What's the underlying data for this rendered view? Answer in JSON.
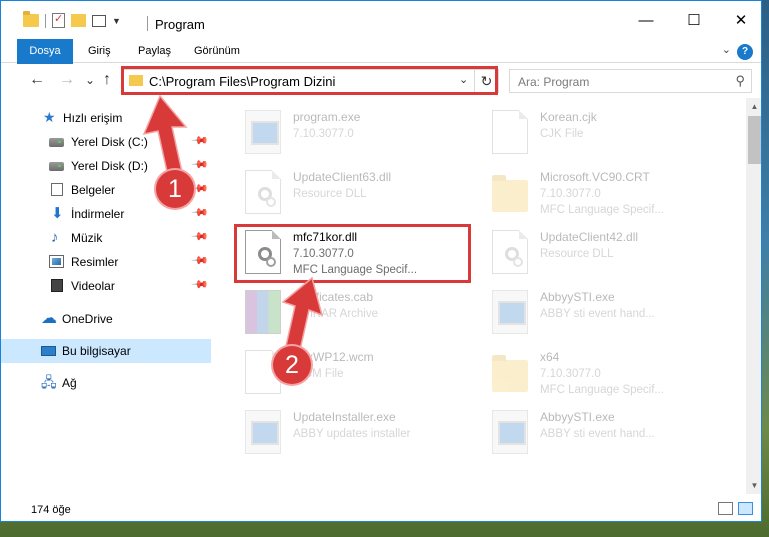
{
  "window": {
    "title": "Program",
    "controls": {
      "minimize": "—",
      "maximize": "☐",
      "close": "✕"
    }
  },
  "ribbon": {
    "tabs": [
      "Dosya",
      "Giriş",
      "Paylaş",
      "Görünüm"
    ],
    "help": "?"
  },
  "nav": {
    "back": "←",
    "forward": "→",
    "recent": "⌄",
    "up": "↑",
    "address": "C:\\Program Files\\Program Dizini",
    "search_placeholder": "Ara: Program"
  },
  "sidebar": {
    "items": [
      {
        "label": "Hızlı erişim",
        "icon": "star-icon",
        "pinned": false
      },
      {
        "label": "Yerel Disk (C:)",
        "icon": "drive-icon",
        "pinned": true
      },
      {
        "label": "Yerel Disk (D:)",
        "icon": "drive-icon",
        "pinned": true
      },
      {
        "label": "Belgeler",
        "icon": "documents-icon",
        "pinned": true
      },
      {
        "label": "İndirmeler",
        "icon": "downloads-icon",
        "pinned": true
      },
      {
        "label": "Müzik",
        "icon": "music-icon",
        "pinned": true
      },
      {
        "label": "Resimler",
        "icon": "pictures-icon",
        "pinned": true
      },
      {
        "label": "Videolar",
        "icon": "videos-icon",
        "pinned": true
      },
      {
        "label": "OneDrive",
        "icon": "onedrive-icon",
        "pinned": false
      },
      {
        "label": "Bu bilgisayar",
        "icon": "this-pc-icon",
        "pinned": false,
        "selected": true
      },
      {
        "label": "Ağ",
        "icon": "network-icon",
        "pinned": false
      }
    ]
  },
  "files": [
    {
      "name": "program.exe",
      "line2": "7.10.3077.0",
      "line3": "",
      "icon": "exe-icon"
    },
    {
      "name": "Korean.cjk",
      "line2": "CJK File",
      "line3": "",
      "icon": "file-icon"
    },
    {
      "name": "UpdateClient63.dll",
      "line2": "Resource DLL",
      "line3": "",
      "icon": "dll-icon"
    },
    {
      "name": "Microsoft.VC90.CRT",
      "line2": "7.10.3077.0",
      "line3": "MFC Language Specif...",
      "icon": "folder-icon"
    },
    {
      "name": "mfc71kor.dll",
      "line2": "7.10.3077.0",
      "line3": "MFC Language Specif...",
      "icon": "dll-icon",
      "highlighted": true
    },
    {
      "name": "UpdateClient42.dll",
      "line2": "Resource DLL",
      "line3": "",
      "icon": "dll-icon"
    },
    {
      "name": "certificates.cab",
      "line2": "WinRAR Archive",
      "line3": "",
      "icon": "archive-icon"
    },
    {
      "name": "AbbyySTI.exe",
      "line2": "ABBY sti event hand...",
      "line3": "",
      "icon": "exe-icon"
    },
    {
      "name": "FaxWP12.wcm",
      "line2": "WCM File",
      "line3": "",
      "icon": "file-icon"
    },
    {
      "name": "x64",
      "line2": "7.10.3077.0",
      "line3": "MFC Language Specif...",
      "icon": "folder-icon"
    },
    {
      "name": "UpdateInstaller.exe",
      "line2": "ABBY updates installer",
      "line3": "",
      "icon": "exe-icon"
    },
    {
      "name": "AbbyySTI.exe",
      "line2": "ABBY sti event hand...",
      "line3": "",
      "icon": "exe-icon"
    }
  ],
  "status": {
    "count": "174 öğe"
  },
  "annotations": {
    "step1": "1",
    "step2": "2",
    "color": "#d83a3a"
  }
}
